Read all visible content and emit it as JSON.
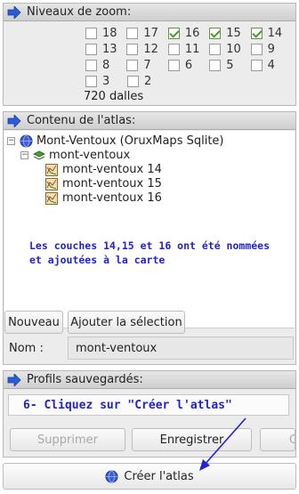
{
  "zoom": {
    "title": "Niveaux de zoom:",
    "rows": [
      [
        {
          "label": "18",
          "checked": false
        },
        {
          "label": "17",
          "checked": false
        },
        {
          "label": "16",
          "checked": true
        },
        {
          "label": "15",
          "checked": true
        },
        {
          "label": "14",
          "checked": true
        }
      ],
      [
        {
          "label": "13",
          "checked": false
        },
        {
          "label": "12",
          "checked": false
        },
        {
          "label": "11",
          "checked": false
        },
        {
          "label": "10",
          "checked": false
        },
        {
          "label": "9",
          "checked": false
        }
      ],
      [
        {
          "label": "8",
          "checked": false
        },
        {
          "label": "7",
          "checked": false
        },
        {
          "label": "6",
          "checked": false
        },
        {
          "label": "5",
          "checked": false
        },
        {
          "label": "4",
          "checked": false
        }
      ],
      [
        {
          "label": "3",
          "checked": false
        },
        {
          "label": "2",
          "checked": false
        }
      ]
    ],
    "tiles_count": "720 dalles"
  },
  "atlas": {
    "title": "Contenu de l'atlas:",
    "root": "Mont-Ventoux (OruxMaps Sqlite)",
    "layer": "mont-ventoux",
    "levels": [
      "mont-ventoux 14",
      "mont-ventoux 15",
      "mont-ventoux 16"
    ],
    "note": "Les couches 14,15 et 16 ont été nommées et ajoutées à la carte",
    "new_button": "Nouveau",
    "add_selection_button": "Ajouter la sélection",
    "name_label": "Nom :",
    "name_value": "mont-ventoux"
  },
  "profiles": {
    "title": "Profils sauvegardés:",
    "instruction": "6- Cliquez sur \"Créer l'atlas\"",
    "delete_button": "Supprimer",
    "save_button": "Enregistrer",
    "third_button": "C"
  },
  "create_button": "Créer l'atlas",
  "colors": {
    "arrow": "#2a5bd8",
    "annotation": "#2323c8",
    "check": "#4a9a2a"
  }
}
